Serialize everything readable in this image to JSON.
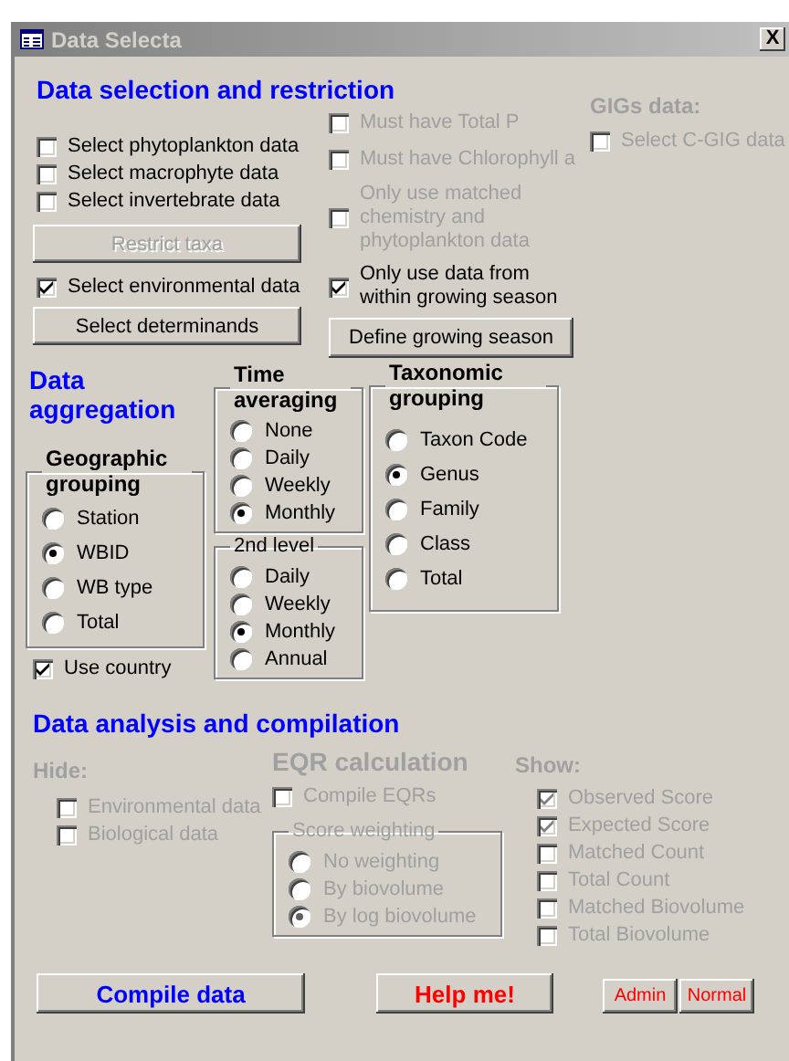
{
  "window": {
    "title": "Data Selecta",
    "close": "X"
  },
  "selection": {
    "heading": "Data selection and restriction",
    "left": [
      {
        "kind": "checkbox",
        "label": "Select phytoplankton data",
        "checked": false,
        "disabled": false
      },
      {
        "kind": "checkbox",
        "label": "Select macrophyte data",
        "checked": false,
        "disabled": false
      },
      {
        "kind": "checkbox",
        "label": "Select invertebrate data",
        "checked": false,
        "disabled": false
      },
      {
        "kind": "button",
        "label": "Restrict taxa",
        "disabled": true
      },
      {
        "kind": "checkbox",
        "label": "Select environmental data",
        "checked": true,
        "disabled": false
      },
      {
        "kind": "button",
        "label": "Select determinands",
        "disabled": false
      }
    ],
    "middle": [
      {
        "kind": "checkbox",
        "label": "Must have Total P",
        "checked": false,
        "disabled": true
      },
      {
        "kind": "checkbox",
        "label": "Must have Chlorophyll a",
        "checked": false,
        "disabled": true
      },
      {
        "kind": "checkbox",
        "label": "Only use matched chemistry and phytoplankton data",
        "checked": false,
        "disabled": true
      },
      {
        "kind": "checkbox",
        "label": "Only use data from within growing season",
        "checked": true,
        "disabled": false
      },
      {
        "kind": "button",
        "label": "Define growing season",
        "disabled": false
      }
    ],
    "gigs": {
      "heading": "GIGs data:",
      "disabled": true,
      "options": [
        {
          "kind": "checkbox",
          "label": "Select C-GIG data",
          "checked": false,
          "disabled": true
        }
      ]
    }
  },
  "aggregation": {
    "heading": "Data aggregation",
    "geographic": {
      "title": "Geographic grouping",
      "disabled": false,
      "options": [
        {
          "label": "Station",
          "selected": false
        },
        {
          "label": "WBID",
          "selected": true
        },
        {
          "label": "WB type",
          "selected": false
        },
        {
          "label": "Total",
          "selected": false
        }
      ]
    },
    "use_country": {
      "label": "Use country",
      "checked": true,
      "disabled": false
    },
    "time_averaging": {
      "title": "Time averaging",
      "disabled": false,
      "options": [
        {
          "label": "None",
          "selected": false
        },
        {
          "label": "Daily",
          "selected": false
        },
        {
          "label": "Weekly",
          "selected": false
        },
        {
          "label": "Monthly",
          "selected": true
        }
      ]
    },
    "second_level": {
      "title": "2nd level",
      "disabled": false,
      "options": [
        {
          "label": "Daily",
          "selected": false
        },
        {
          "label": "Weekly",
          "selected": false
        },
        {
          "label": "Monthly",
          "selected": true
        },
        {
          "label": "Annual",
          "selected": false
        }
      ]
    },
    "taxonomic": {
      "title": "Taxonomic grouping",
      "disabled": false,
      "options": [
        {
          "label": "Taxon Code",
          "selected": false
        },
        {
          "label": "Genus",
          "selected": true
        },
        {
          "label": "Family",
          "selected": false
        },
        {
          "label": "Class",
          "selected": false
        },
        {
          "label": "Total",
          "selected": false
        }
      ]
    }
  },
  "analysis": {
    "heading": "Data analysis and compilation",
    "hide": {
      "heading": "Hide:",
      "disabled": true,
      "options": [
        {
          "label": "Environmental data",
          "checked": false,
          "disabled": true
        },
        {
          "label": "Biological data",
          "checked": false,
          "disabled": true
        }
      ]
    },
    "eqr": {
      "heading": "EQR calculation",
      "disabled": true,
      "compile": {
        "label": "Compile EQRs",
        "checked": false,
        "disabled": true
      },
      "weighting": {
        "title": "Score weighting",
        "disabled": true,
        "options": [
          {
            "label": "No weighting",
            "selected": false
          },
          {
            "label": "By biovolume",
            "selected": false
          },
          {
            "label": "By log biovolume",
            "selected": true
          }
        ]
      }
    },
    "show": {
      "heading": "Show:",
      "disabled": true,
      "options": [
        {
          "label": "Observed Score",
          "checked": true,
          "disabled": true
        },
        {
          "label": "Expected Score",
          "checked": true,
          "disabled": true
        },
        {
          "label": "Matched Count",
          "checked": false,
          "disabled": true
        },
        {
          "label": "Total Count",
          "checked": false,
          "disabled": true
        },
        {
          "label": "Matched Biovolume",
          "checked": false,
          "disabled": true
        },
        {
          "label": "Total Biovolume",
          "checked": false,
          "disabled": true
        }
      ]
    }
  },
  "buttons": [
    {
      "kind": "large",
      "label": "Compile data",
      "color": "#0000ff"
    },
    {
      "kind": "medium",
      "label": "Help me!",
      "color": "#ff0000"
    },
    {
      "kind": "small",
      "label": "Admin",
      "color": "#ff0000"
    },
    {
      "kind": "small",
      "label": "Normal",
      "color": "#ff0000"
    }
  ]
}
